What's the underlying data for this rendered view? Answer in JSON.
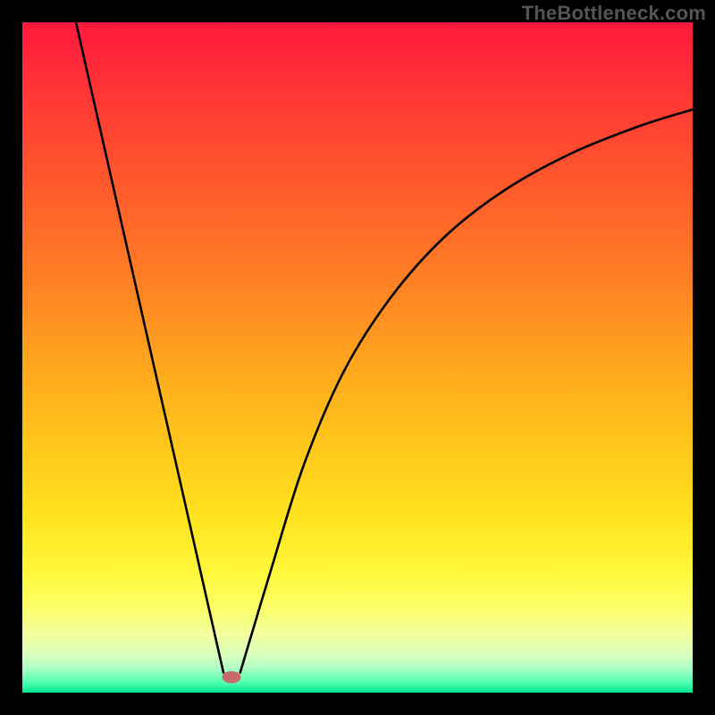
{
  "watermark": "TheBottleneck.com",
  "chart_data": {
    "type": "line",
    "title": "",
    "xlabel": "",
    "ylabel": "",
    "xlim": [
      0,
      100
    ],
    "ylim": [
      0,
      100
    ],
    "background_gradient_stops": [
      {
        "offset": 0.0,
        "color": "#ff183d"
      },
      {
        "offset": 0.12,
        "color": "#ff3a34"
      },
      {
        "offset": 0.25,
        "color": "#ff5b2b"
      },
      {
        "offset": 0.38,
        "color": "#ff7e24"
      },
      {
        "offset": 0.5,
        "color": "#ffa31e"
      },
      {
        "offset": 0.62,
        "color": "#ffc41b"
      },
      {
        "offset": 0.74,
        "color": "#ffe31f"
      },
      {
        "offset": 0.82,
        "color": "#fff83a"
      },
      {
        "offset": 0.875,
        "color": "#fcff6a"
      },
      {
        "offset": 0.915,
        "color": "#f1ffa0"
      },
      {
        "offset": 0.945,
        "color": "#d6ffbe"
      },
      {
        "offset": 0.965,
        "color": "#a9ffc5"
      },
      {
        "offset": 0.985,
        "color": "#4fffb0"
      },
      {
        "offset": 1.0,
        "color": "#00e38a"
      }
    ],
    "series": [
      {
        "name": "bottleneck-curve",
        "segments": [
          {
            "type": "line",
            "points": [
              {
                "x": 8.0,
                "y": 100.0
              },
              {
                "x": 30.0,
                "y": 3.0
              }
            ]
          },
          {
            "type": "curve",
            "points": [
              {
                "x": 32.5,
                "y": 3.0
              },
              {
                "x": 37.0,
                "y": 18.0
              },
              {
                "x": 42.0,
                "y": 34.0
              },
              {
                "x": 48.0,
                "y": 48.0
              },
              {
                "x": 55.0,
                "y": 59.0
              },
              {
                "x": 63.0,
                "y": 68.0
              },
              {
                "x": 72.0,
                "y": 75.0
              },
              {
                "x": 82.0,
                "y": 80.5
              },
              {
                "x": 92.0,
                "y": 84.5
              },
              {
                "x": 100.0,
                "y": 87.0
              }
            ]
          }
        ]
      }
    ],
    "marker": {
      "name": "optimal-point",
      "x": 31.2,
      "y": 2.3,
      "rx": 1.4,
      "ry": 0.9,
      "color": "#c76a6a"
    }
  }
}
